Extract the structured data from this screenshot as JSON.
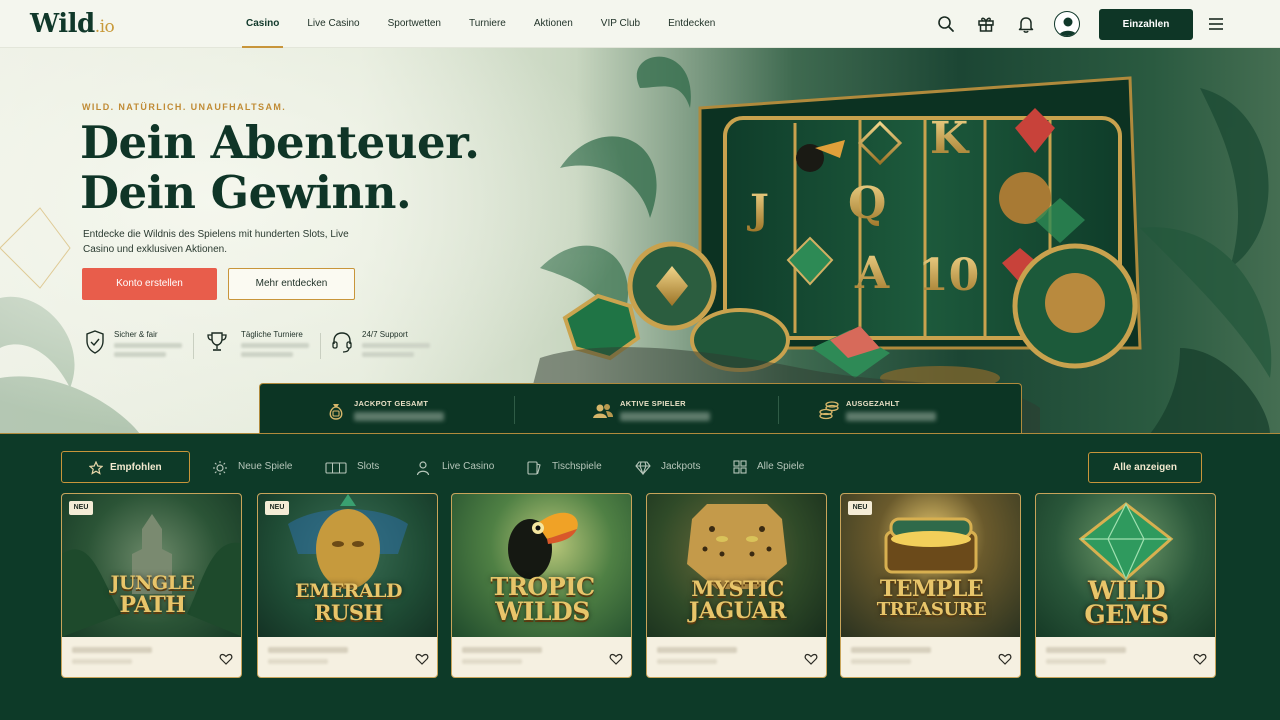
{
  "header": {
    "logo_main": "Wild",
    "logo_tld": ".io",
    "nav": [
      "Casino",
      "Live Casino",
      "Sportwetten",
      "Turniere",
      "Aktionen",
      "VIP Club",
      "Entdecken"
    ],
    "active_nav": "Casino",
    "deposit_label": "Einzahlen"
  },
  "hero": {
    "eyebrow": "WILD. NATÜRLICH. UNAUFHALTSAM.",
    "headline_line1": "Dein Abenteuer.",
    "headline_line2": "Dein Gewinn.",
    "subtext": "Entdecke die Wildnis des Spielens mit hunderten Slots, Live Casino und exklusiven Aktionen.",
    "cta_primary": "Konto erstellen",
    "cta_secondary": "Mehr entdecken",
    "slot_symbols": [
      "J",
      "Q",
      "K",
      "A",
      "10"
    ],
    "features": [
      {
        "label": "Sicher & fair",
        "icon": "shield-check-icon"
      },
      {
        "label": "Tägliche Turniere",
        "icon": "trophy-icon"
      },
      {
        "label": "24/7 Support",
        "icon": "headset-icon"
      }
    ]
  },
  "stats": [
    {
      "label": "JACKPOT GESAMT",
      "icon": "moneybag-icon"
    },
    {
      "label": "AKTIVE SPIELER",
      "icon": "users-icon"
    },
    {
      "label": "AUSGEZAHLT",
      "icon": "coins-icon"
    }
  ],
  "tabs": [
    {
      "label": "Empfohlen",
      "icon": "star-icon"
    },
    {
      "label": "Neue Spiele",
      "icon": "sun-icon"
    },
    {
      "label": "Slots",
      "icon": "slots-icon"
    },
    {
      "label": "Live Casino",
      "icon": "person-icon"
    },
    {
      "label": "Tischspiele",
      "icon": "cards-icon"
    },
    {
      "label": "Jackpots",
      "icon": "diamond-icon"
    },
    {
      "label": "Alle Spiele",
      "icon": "grid-icon"
    }
  ],
  "active_tab": "Empfohlen",
  "show_all_label": "Alle anzeigen",
  "games": [
    {
      "title_line1": "JUNGLE",
      "title_line2": "PATH",
      "badge": "NEU"
    },
    {
      "title_line1": "EMERALD",
      "title_line2": "RUSH",
      "badge": "NEU"
    },
    {
      "title_line1": "TROPIC",
      "title_line2": "WILDS",
      "badge": ""
    },
    {
      "title_line1": "MYSTIC",
      "title_line2": "JAGUAR",
      "badge": ""
    },
    {
      "title_line1": "TEMPLE",
      "title_line2": "TREASURE",
      "badge": "NEU"
    },
    {
      "title_line1": "WILD",
      "title_line2": "GEMS",
      "badge": ""
    }
  ],
  "colors": {
    "brand_green": "#0e3626",
    "accent_gold": "#c8953a",
    "cta_red": "#e85d4b",
    "header_bg": "#f4f6ee"
  }
}
